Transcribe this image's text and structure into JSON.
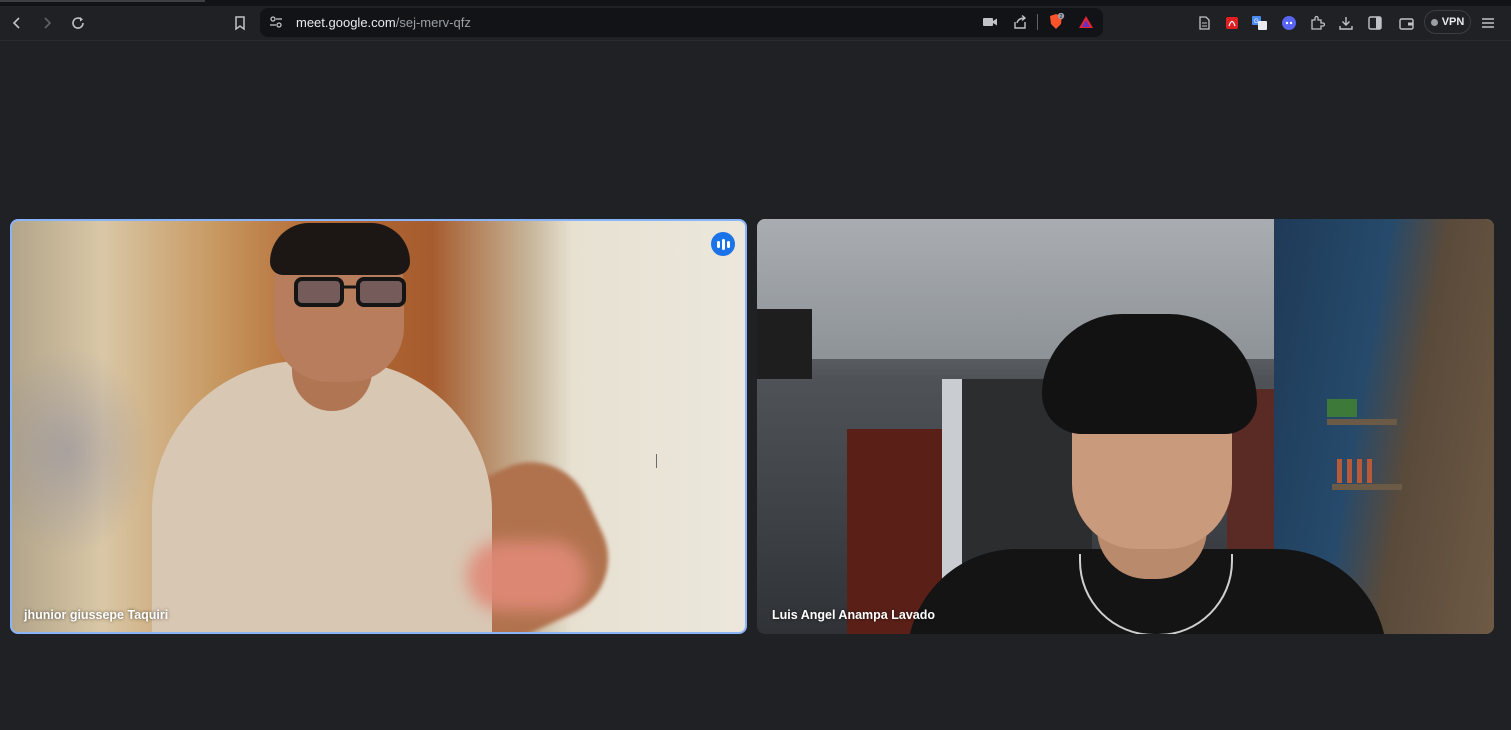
{
  "browser": {
    "url_domain": "meet.google.com",
    "url_path": "/sej-merv-qfz",
    "vpn_label": "VPN",
    "icons": [
      "back-icon",
      "forward-icon",
      "reload-icon",
      "bookmark-icon",
      "site-settings-icon",
      "camera-icon",
      "share-icon",
      "brave-shields-icon",
      "brave-rewards-icon",
      "reader-icon",
      "pdf-icon",
      "translate-icon",
      "discord-icon",
      "extensions-icon",
      "downloads-icon",
      "sidebar-icon",
      "wallet-icon",
      "menu-icon"
    ]
  },
  "meeting": {
    "participants": [
      {
        "name": "jhunior giussepe Taquiri",
        "speaking": true
      },
      {
        "name": "Luis Angel Anampa Lavado",
        "speaking": false
      }
    ]
  },
  "colors": {
    "background": "#202124",
    "active_speaker_border": "#8ab4f8",
    "speaking_badge": "#1a73e8"
  }
}
